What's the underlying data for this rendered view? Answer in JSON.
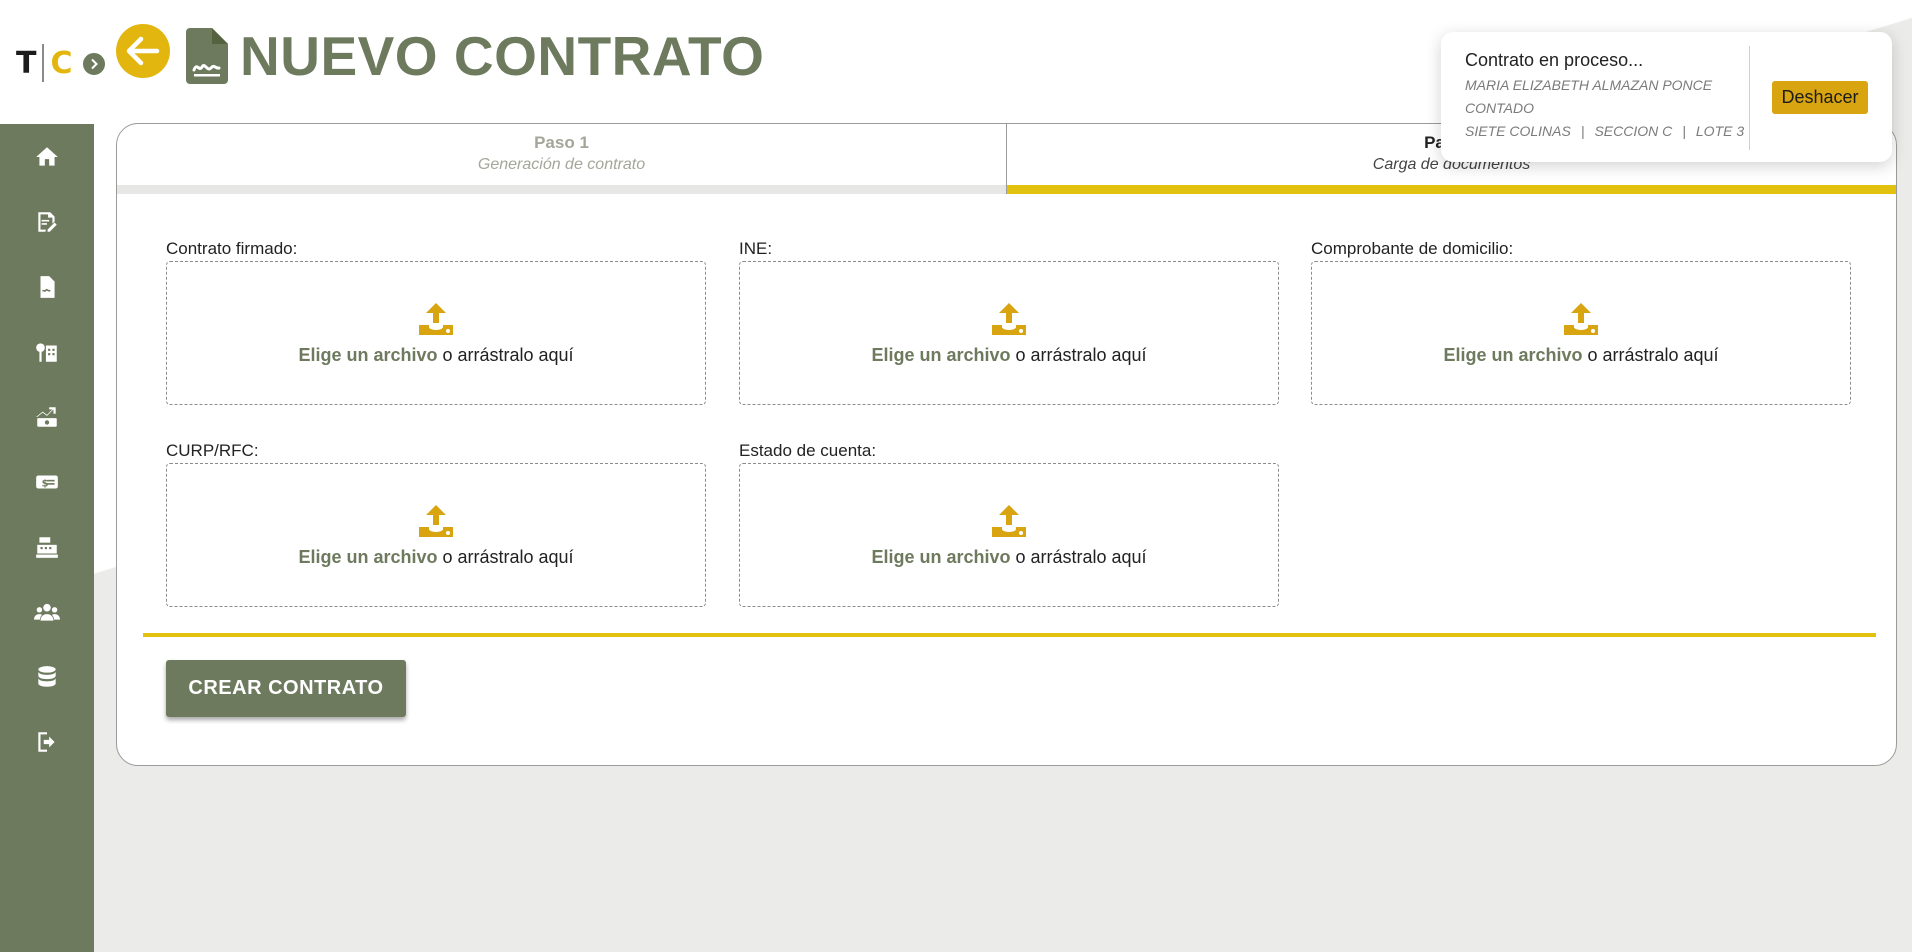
{
  "app": {
    "logo_t": "T",
    "logo_c": "C",
    "brand_color": "#6d7a5e",
    "accent_color": "#e3c20f"
  },
  "sidebar": {
    "items": [
      {
        "icon": "home-icon",
        "label": "Inicio"
      },
      {
        "icon": "contract-edit-icon",
        "label": "Contratos"
      },
      {
        "icon": "document-icon",
        "label": "Documentos"
      },
      {
        "icon": "property-icon",
        "label": "Propiedades"
      },
      {
        "icon": "payments-icon",
        "label": "Pagos"
      },
      {
        "icon": "money-icon",
        "label": "Cobranza"
      },
      {
        "icon": "cash-register-icon",
        "label": "Caja"
      },
      {
        "icon": "users-icon",
        "label": "Clientes"
      },
      {
        "icon": "database-icon",
        "label": "Base de datos"
      },
      {
        "icon": "logout-icon",
        "label": "Salir"
      }
    ]
  },
  "header": {
    "title": "NUEVO CONTRATO"
  },
  "steps": [
    {
      "title": "Paso 1",
      "subtitle": "Generación de contrato",
      "active": false
    },
    {
      "title": "Paso 2",
      "subtitle": "Carga de documentos",
      "active": true
    }
  ],
  "uploads": {
    "choose_text": "Elige un archivo",
    "drag_text": " o arrástralo aquí",
    "fields": [
      {
        "label": "Contrato firmado:"
      },
      {
        "label": "INE:"
      },
      {
        "label": "Comprobante de domicilio:"
      },
      {
        "label": "CURP/RFC:"
      },
      {
        "label": "Estado de cuenta:"
      }
    ]
  },
  "actions": {
    "create_label": "CREAR CONTRATO"
  },
  "toast": {
    "title": "Contrato en proceso...",
    "client": "MARIA ELIZABETH ALMAZAN PONCE",
    "payment": "CONTADO",
    "location": "SIETE COLINAS",
    "section": "SECCION C",
    "lot": "LOTE 3",
    "separator": "|",
    "undo_label": "Deshacer"
  }
}
